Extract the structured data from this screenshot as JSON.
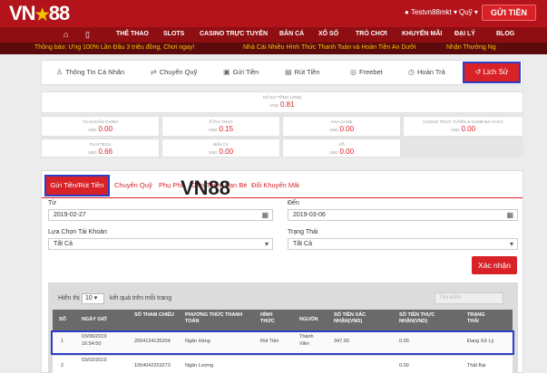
{
  "header": {
    "logo_text": "VN",
    "logo_num": "88",
    "username": "Testvn88mkt",
    "wallet_label": "Quỹ",
    "deposit_button": "GỬI TIỀN"
  },
  "nav": {
    "items": [
      "THỂ THAO",
      "SLOTS",
      "CASINO TRỰC TUYẾN",
      "BẮN CÁ",
      "XỔ SỐ",
      "TRÒ CHƠI",
      "KHUYẾN MÃI",
      "ĐẠI LÝ",
      "BLOG"
    ]
  },
  "ticker": {
    "msg1": "Thông báo: Ưng 100% Lần Đầu 3 triệu đồng, Chơi ngay!",
    "msg2": "Nhà Cái Nhiều Hình Thức Thanh Toán và Hoàn Tiền An Dưỡi",
    "msg3": "Nhận Thưởng Ng"
  },
  "account_menu": {
    "items": [
      "Thông Tin Cá Nhân",
      "Chuyển Quỹ",
      "Gửi Tiền",
      "Rút Tiền",
      "Freebet",
      "Hoàn Trả"
    ],
    "active": "Lịch Sử"
  },
  "balances": {
    "currency": "VND",
    "total": {
      "label": "SỐ DƯ TỔNG (VND)",
      "value": "0.81"
    },
    "row1": [
      {
        "label": "TÀI KHOẢN CHÍNH",
        "value": "0.00"
      },
      {
        "label": "Ổ PHI THAO",
        "value": "0.15"
      },
      {
        "label": "AVIA GAME",
        "value": "0.00"
      },
      {
        "label": "CASINO TRỰC TUYẾN & GAME BÀI KHÁC",
        "value": "0.00"
      }
    ],
    "row2": [
      {
        "label": "PLAYTECH",
        "value": "0.66"
      },
      {
        "label": "BẮN CÁ",
        "value": "0.00"
      },
      {
        "label": "XỔ",
        "value": "0.00"
      }
    ]
  },
  "tabs": {
    "active": "Gửi Tiền/Rút Tiền",
    "items": [
      "Chuyển Quỹ",
      "Phụ Phí",
      "Giới Thiệu Bạn Bè",
      "Đổi Khuyến Mãi"
    ]
  },
  "filters": {
    "from_label": "Từ",
    "from_value": "2019-02-27",
    "to_label": "Đến",
    "to_value": "2019-03-06",
    "account_label": "Lựa Chọn Tài Khoản",
    "account_value": "Tất Cả",
    "status_label": "Trạng Thái",
    "status_value": "Tất Cả",
    "confirm": "Xác nhận"
  },
  "table": {
    "show_prefix": "Hiển thị",
    "per_page": "10",
    "show_suffix": "kết quả trên mỗi trang",
    "search_placeholder": "Tìm kiếm",
    "headers": [
      "SỐ",
      "NGÀY GIỜ",
      "SỐ THAM CHIẾU",
      "PHƯƠNG THỨC THANH TOÁN",
      "HÌNH THỨC",
      "NGUỒN",
      "SỐ TIỀN XÁC NHẬN(VND)",
      "SỐ TIỀN THỰC NHẬN(VND)",
      "TRẠNG THÁI"
    ],
    "rows": [
      {
        "no": "1",
        "date": "03/06/2019",
        "time": "16:54:50",
        "ref": "2054134135204",
        "method": "Ngân Hàng",
        "type": "Rút Tiền",
        "source1": "Thành",
        "source2": "Viên",
        "confirmed": "347.00",
        "received": "0.00",
        "status": "Đang Xử Lý"
      },
      {
        "no": "2",
        "date": "03/02/2019",
        "time": "",
        "ref": "1054042253273",
        "method": "Ngân Lượng",
        "type": "",
        "source1": "",
        "source2": "",
        "confirmed": "",
        "received": "0.00",
        "status": "Thất Bại"
      }
    ]
  },
  "watermark": "VN88",
  "icons": {
    "user": "user-icon",
    "calendar": "calendar-icon",
    "chevron": "chevron-down-icon",
    "history": "history-icon"
  },
  "colors": {
    "brand": "#b3141b",
    "accent": "#d82228",
    "highlight": "#2b3ec8"
  }
}
